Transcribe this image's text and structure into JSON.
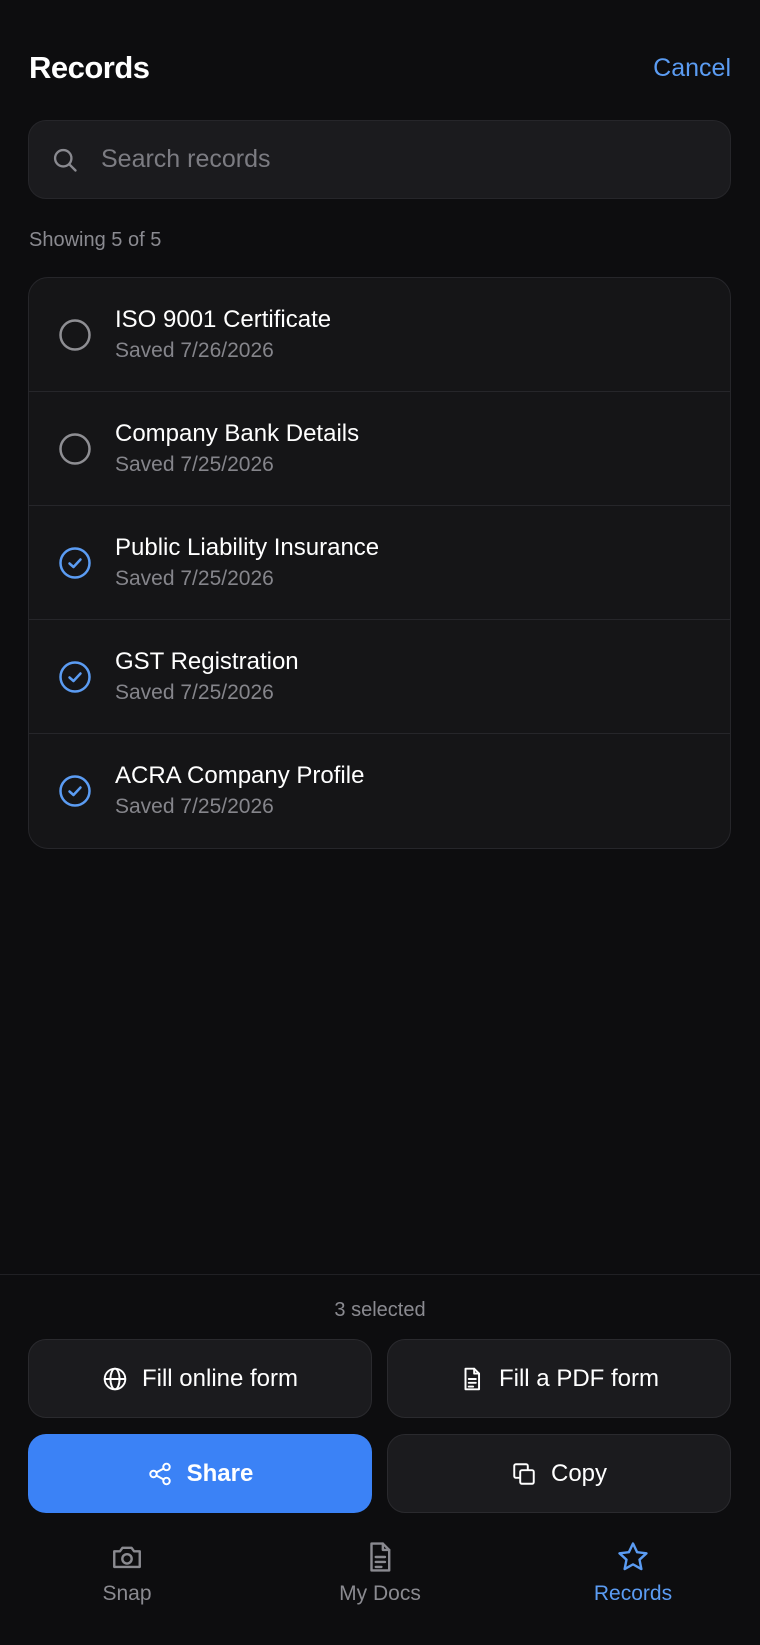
{
  "header": {
    "title": "Records",
    "cancel_label": "Cancel"
  },
  "search": {
    "placeholder": "Search records",
    "value": ""
  },
  "list": {
    "showing_label": "Showing 5 of 5",
    "items": [
      {
        "title": "ISO 9001 Certificate",
        "date": "Saved 7/26/2026",
        "selected": false
      },
      {
        "title": "Company Bank Details",
        "date": "Saved 7/25/2026",
        "selected": false
      },
      {
        "title": "Public Liability Insurance",
        "date": "Saved 7/25/2026",
        "selected": true
      },
      {
        "title": "GST Registration",
        "date": "Saved 7/25/2026",
        "selected": true
      },
      {
        "title": "ACRA Company Profile",
        "date": "Saved 7/25/2026",
        "selected": true
      }
    ]
  },
  "actions": {
    "selected_label": "3 selected",
    "fill_online_label": "Fill online form",
    "fill_pdf_label": "Fill a PDF form",
    "share_label": "Share",
    "copy_label": "Copy"
  },
  "tabs": [
    {
      "label": "Snap",
      "icon": "camera-icon",
      "active": false
    },
    {
      "label": "My Docs",
      "icon": "document-icon",
      "active": false
    },
    {
      "label": "Records",
      "icon": "star-icon",
      "active": true
    }
  ],
  "colors": {
    "background": "#0d0d0f",
    "card": "#151517",
    "accent": "#5b9cf3",
    "primary_button": "#3b82f6",
    "muted_text": "#8a8a90",
    "unselected_circle": "#8e8e93"
  }
}
